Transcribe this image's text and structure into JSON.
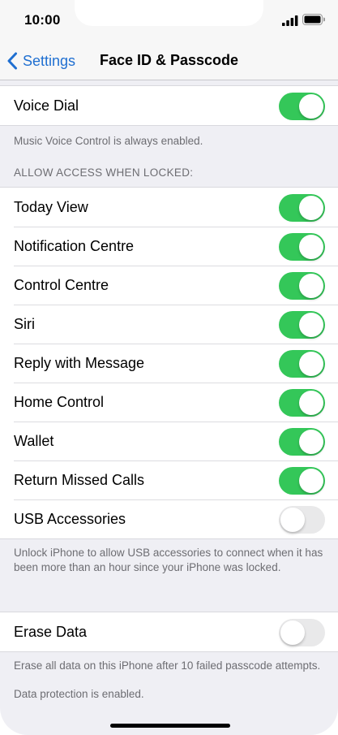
{
  "status_bar": {
    "time": "10:00"
  },
  "nav": {
    "back_label": "Settings",
    "title": "Face ID & Passcode"
  },
  "voice_dial": {
    "label": "Voice Dial",
    "on": true,
    "footer": "Music Voice Control is always enabled."
  },
  "locked_section": {
    "header": "ALLOW ACCESS WHEN LOCKED:",
    "items": [
      {
        "label": "Today View",
        "on": true
      },
      {
        "label": "Notification Centre",
        "on": true
      },
      {
        "label": "Control Centre",
        "on": true
      },
      {
        "label": "Siri",
        "on": true
      },
      {
        "label": "Reply with Message",
        "on": true
      },
      {
        "label": "Home Control",
        "on": true
      },
      {
        "label": "Wallet",
        "on": true
      },
      {
        "label": "Return Missed Calls",
        "on": true
      },
      {
        "label": "USB Accessories",
        "on": false
      }
    ],
    "footer": "Unlock iPhone to allow USB accessories to connect when it has been more than an hour since your iPhone was locked."
  },
  "erase": {
    "label": "Erase Data",
    "on": false,
    "footer": "Erase all data on this iPhone after 10 failed passcode attempts.",
    "note": "Data protection is enabled."
  },
  "colors": {
    "accent": "#1f6fd1",
    "toggle_on": "#34c759",
    "toggle_off": "#e9e9ea",
    "background": "#efeff4"
  },
  "icons": [
    "signal-icon",
    "battery-icon",
    "back-chevron-icon"
  ]
}
